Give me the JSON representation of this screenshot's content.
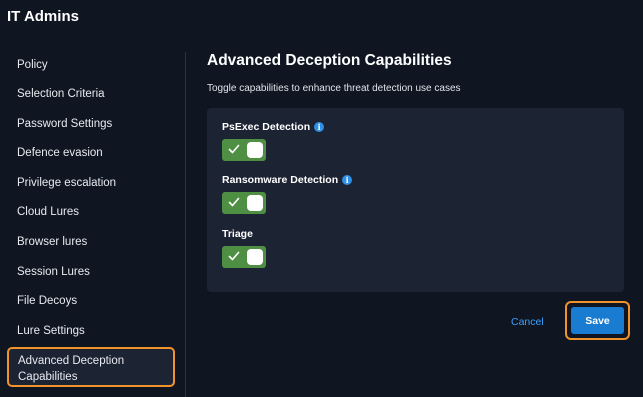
{
  "app": {
    "title": "IT Admins"
  },
  "sidebar": {
    "items": [
      {
        "label": "Policy"
      },
      {
        "label": "Selection Criteria"
      },
      {
        "label": "Password Settings"
      },
      {
        "label": "Defence evasion"
      },
      {
        "label": "Privilege escalation"
      },
      {
        "label": "Cloud Lures"
      },
      {
        "label": "Browser lures"
      },
      {
        "label": "Session Lures"
      },
      {
        "label": "File Decoys"
      },
      {
        "label": "Lure Settings"
      },
      {
        "label": "Advanced Deception Capabilities",
        "active": true
      }
    ]
  },
  "main": {
    "title": "Advanced Deception Capabilities",
    "subtitle": "Toggle capabilities to enhance threat detection use cases",
    "capabilities": [
      {
        "label": "PsExec Detection",
        "info_icon": "info-icon",
        "enabled": true
      },
      {
        "label": "Ransomware Detection",
        "info_icon": "info-icon",
        "enabled": true
      },
      {
        "label": "Triage",
        "enabled": true
      }
    ]
  },
  "actions": {
    "cancel_label": "Cancel",
    "save_label": "Save"
  },
  "colors": {
    "background": "#0f1521",
    "card": "#1c2333",
    "toggle_on": "#4e8f43",
    "accent_blue": "#1a7cd0",
    "link_blue": "#3aa0ff",
    "highlight_orange": "#f0932b"
  }
}
